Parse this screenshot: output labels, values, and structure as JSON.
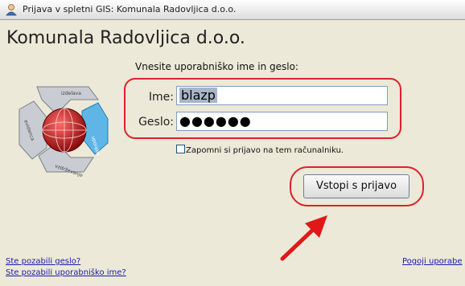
{
  "window": {
    "title": "Prijava v spletni GIS: Komunala Radovljica d.o.o."
  },
  "company": {
    "name": "Komunala Radovljica d.o.o."
  },
  "login": {
    "prompt": "Vnesite uporabniško ime in geslo:",
    "username_label": "Ime:",
    "username_value": "blazp",
    "password_label": "Geslo:",
    "password_value": "●●●●●●",
    "remember_label": "Zapomni si prijavo na tem računalniku.",
    "remember_checked": false,
    "submit_label": "Vstopi s prijavo"
  },
  "links": {
    "forgot_password": "Ste pozabili geslo?",
    "forgot_username": "Ste pozabili uporabniško ime?",
    "terms": "Pogoji uporabe"
  },
  "logo": {
    "arrow_labels": [
      "izdelava",
      "uporaba",
      "vzdrževanje",
      "evidenca"
    ]
  },
  "colors": {
    "highlight": "#e0202a",
    "background": "#ece9d8",
    "link": "#1a1ab0"
  }
}
